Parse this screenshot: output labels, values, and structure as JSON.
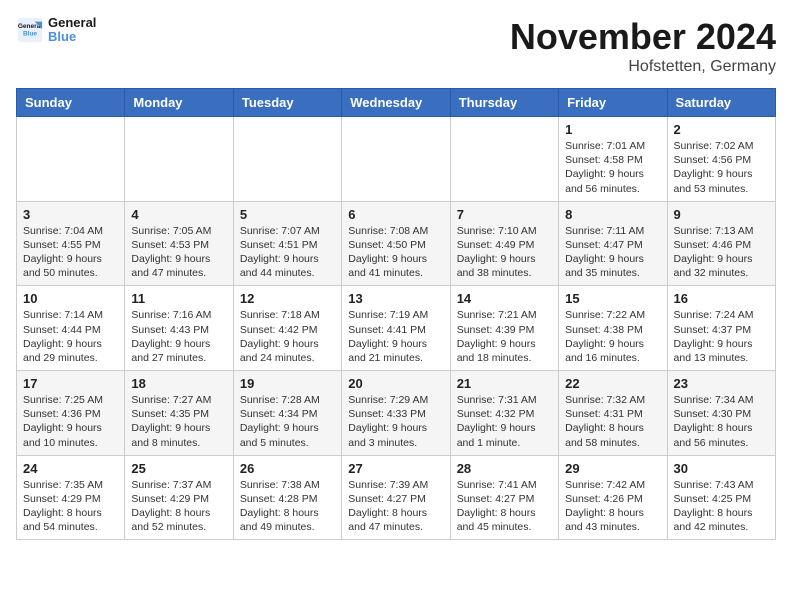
{
  "header": {
    "logo_line1": "General",
    "logo_line2": "Blue",
    "month_title": "November 2024",
    "location": "Hofstetten, Germany"
  },
  "days_of_week": [
    "Sunday",
    "Monday",
    "Tuesday",
    "Wednesday",
    "Thursday",
    "Friday",
    "Saturday"
  ],
  "weeks": [
    [
      {
        "day": "",
        "info": ""
      },
      {
        "day": "",
        "info": ""
      },
      {
        "day": "",
        "info": ""
      },
      {
        "day": "",
        "info": ""
      },
      {
        "day": "",
        "info": ""
      },
      {
        "day": "1",
        "info": "Sunrise: 7:01 AM\nSunset: 4:58 PM\nDaylight: 9 hours and 56 minutes."
      },
      {
        "day": "2",
        "info": "Sunrise: 7:02 AM\nSunset: 4:56 PM\nDaylight: 9 hours and 53 minutes."
      }
    ],
    [
      {
        "day": "3",
        "info": "Sunrise: 7:04 AM\nSunset: 4:55 PM\nDaylight: 9 hours and 50 minutes."
      },
      {
        "day": "4",
        "info": "Sunrise: 7:05 AM\nSunset: 4:53 PM\nDaylight: 9 hours and 47 minutes."
      },
      {
        "day": "5",
        "info": "Sunrise: 7:07 AM\nSunset: 4:51 PM\nDaylight: 9 hours and 44 minutes."
      },
      {
        "day": "6",
        "info": "Sunrise: 7:08 AM\nSunset: 4:50 PM\nDaylight: 9 hours and 41 minutes."
      },
      {
        "day": "7",
        "info": "Sunrise: 7:10 AM\nSunset: 4:49 PM\nDaylight: 9 hours and 38 minutes."
      },
      {
        "day": "8",
        "info": "Sunrise: 7:11 AM\nSunset: 4:47 PM\nDaylight: 9 hours and 35 minutes."
      },
      {
        "day": "9",
        "info": "Sunrise: 7:13 AM\nSunset: 4:46 PM\nDaylight: 9 hours and 32 minutes."
      }
    ],
    [
      {
        "day": "10",
        "info": "Sunrise: 7:14 AM\nSunset: 4:44 PM\nDaylight: 9 hours and 29 minutes."
      },
      {
        "day": "11",
        "info": "Sunrise: 7:16 AM\nSunset: 4:43 PM\nDaylight: 9 hours and 27 minutes."
      },
      {
        "day": "12",
        "info": "Sunrise: 7:18 AM\nSunset: 4:42 PM\nDaylight: 9 hours and 24 minutes."
      },
      {
        "day": "13",
        "info": "Sunrise: 7:19 AM\nSunset: 4:41 PM\nDaylight: 9 hours and 21 minutes."
      },
      {
        "day": "14",
        "info": "Sunrise: 7:21 AM\nSunset: 4:39 PM\nDaylight: 9 hours and 18 minutes."
      },
      {
        "day": "15",
        "info": "Sunrise: 7:22 AM\nSunset: 4:38 PM\nDaylight: 9 hours and 16 minutes."
      },
      {
        "day": "16",
        "info": "Sunrise: 7:24 AM\nSunset: 4:37 PM\nDaylight: 9 hours and 13 minutes."
      }
    ],
    [
      {
        "day": "17",
        "info": "Sunrise: 7:25 AM\nSunset: 4:36 PM\nDaylight: 9 hours and 10 minutes."
      },
      {
        "day": "18",
        "info": "Sunrise: 7:27 AM\nSunset: 4:35 PM\nDaylight: 9 hours and 8 minutes."
      },
      {
        "day": "19",
        "info": "Sunrise: 7:28 AM\nSunset: 4:34 PM\nDaylight: 9 hours and 5 minutes."
      },
      {
        "day": "20",
        "info": "Sunrise: 7:29 AM\nSunset: 4:33 PM\nDaylight: 9 hours and 3 minutes."
      },
      {
        "day": "21",
        "info": "Sunrise: 7:31 AM\nSunset: 4:32 PM\nDaylight: 9 hours and 1 minute."
      },
      {
        "day": "22",
        "info": "Sunrise: 7:32 AM\nSunset: 4:31 PM\nDaylight: 8 hours and 58 minutes."
      },
      {
        "day": "23",
        "info": "Sunrise: 7:34 AM\nSunset: 4:30 PM\nDaylight: 8 hours and 56 minutes."
      }
    ],
    [
      {
        "day": "24",
        "info": "Sunrise: 7:35 AM\nSunset: 4:29 PM\nDaylight: 8 hours and 54 minutes."
      },
      {
        "day": "25",
        "info": "Sunrise: 7:37 AM\nSunset: 4:29 PM\nDaylight: 8 hours and 52 minutes."
      },
      {
        "day": "26",
        "info": "Sunrise: 7:38 AM\nSunset: 4:28 PM\nDaylight: 8 hours and 49 minutes."
      },
      {
        "day": "27",
        "info": "Sunrise: 7:39 AM\nSunset: 4:27 PM\nDaylight: 8 hours and 47 minutes."
      },
      {
        "day": "28",
        "info": "Sunrise: 7:41 AM\nSunset: 4:27 PM\nDaylight: 8 hours and 45 minutes."
      },
      {
        "day": "29",
        "info": "Sunrise: 7:42 AM\nSunset: 4:26 PM\nDaylight: 8 hours and 43 minutes."
      },
      {
        "day": "30",
        "info": "Sunrise: 7:43 AM\nSunset: 4:25 PM\nDaylight: 8 hours and 42 minutes."
      }
    ]
  ]
}
